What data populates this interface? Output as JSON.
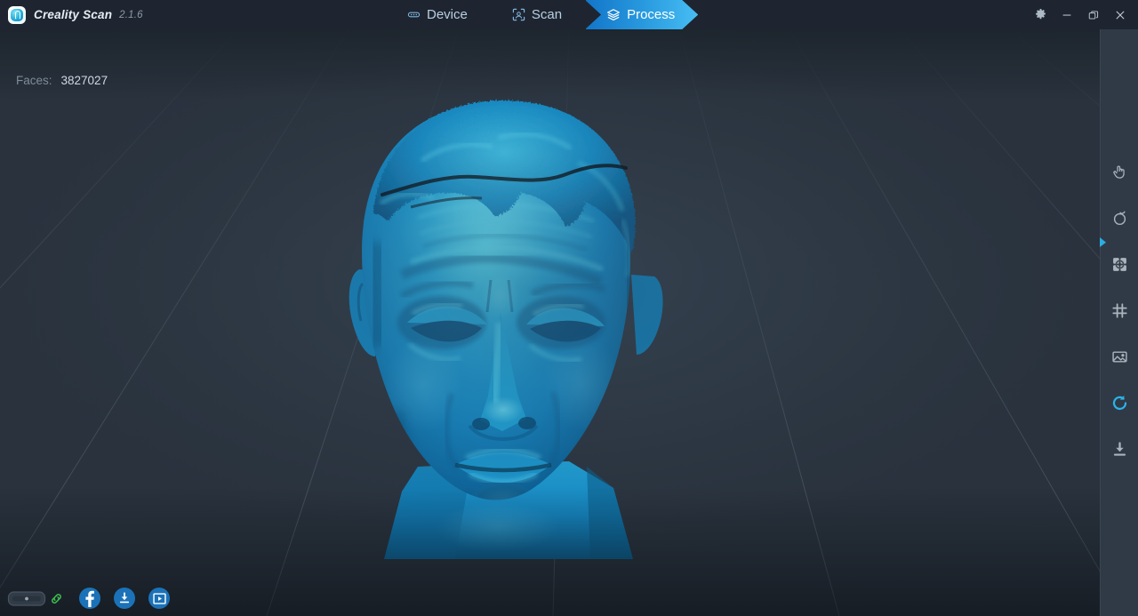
{
  "app": {
    "name": "Creality Scan",
    "version": "2.1.6",
    "logo_icon": "creality-logo-icon"
  },
  "titlebar": {
    "tabs": [
      {
        "id": "device",
        "label": "Device",
        "icon": "usb-connector-icon",
        "active": false
      },
      {
        "id": "scan",
        "label": "Scan",
        "icon": "scan-frame-icon",
        "active": false
      },
      {
        "id": "process",
        "label": "Process",
        "icon": "layers-stack-icon",
        "active": true
      }
    ],
    "window_controls": [
      {
        "id": "settings",
        "icon": "gear-icon",
        "tooltip": "Settings"
      },
      {
        "id": "minimize",
        "icon": "minimize-icon",
        "tooltip": "Minimize"
      },
      {
        "id": "restore",
        "icon": "restore-icon",
        "tooltip": "Restore"
      },
      {
        "id": "close",
        "icon": "close-icon",
        "tooltip": "Close"
      }
    ]
  },
  "viewport": {
    "stats": {
      "faces_label": "Faces:",
      "faces_value": "3827027"
    },
    "model": {
      "name": "scanned-head-mesh",
      "surface_color": "#1596d4",
      "highlight_color": "#46d8f5",
      "shadow_color": "#0a5f92"
    },
    "background_color": "#2a333e",
    "grid_line_color": "#3d4855"
  },
  "sidebar": {
    "items": [
      {
        "id": "select",
        "icon": "hand-pointer-icon",
        "active": false,
        "marker": false
      },
      {
        "id": "rotate",
        "icon": "rotate-loop-icon",
        "active": false,
        "marker": true
      },
      {
        "id": "mesh-edit",
        "icon": "mesh-patch-icon",
        "active": false,
        "marker": false
      },
      {
        "id": "wireframe",
        "icon": "grid-hash-icon",
        "active": false,
        "marker": false
      },
      {
        "id": "texture",
        "icon": "image-photo-icon",
        "active": false,
        "marker": false
      },
      {
        "id": "reset-view",
        "icon": "refresh-circle-icon",
        "active": true,
        "marker": false
      },
      {
        "id": "export",
        "icon": "download-icon",
        "active": false,
        "marker": false
      }
    ],
    "active_color": "#2ab4e8",
    "icon_color": "#aab4bf"
  },
  "bottombar": {
    "device": {
      "id": "scanner-device",
      "icon": "scanner-device-icon",
      "status_icon": "link-chain-icon",
      "status_color": "#3fb950"
    },
    "links": [
      {
        "id": "facebook",
        "icon": "facebook-icon",
        "color": "#1b72b8"
      },
      {
        "id": "download",
        "icon": "download-circle-icon",
        "color": "#1b72b8"
      },
      {
        "id": "tutorial",
        "icon": "video-play-icon",
        "color": "#1b72b8"
      }
    ]
  }
}
